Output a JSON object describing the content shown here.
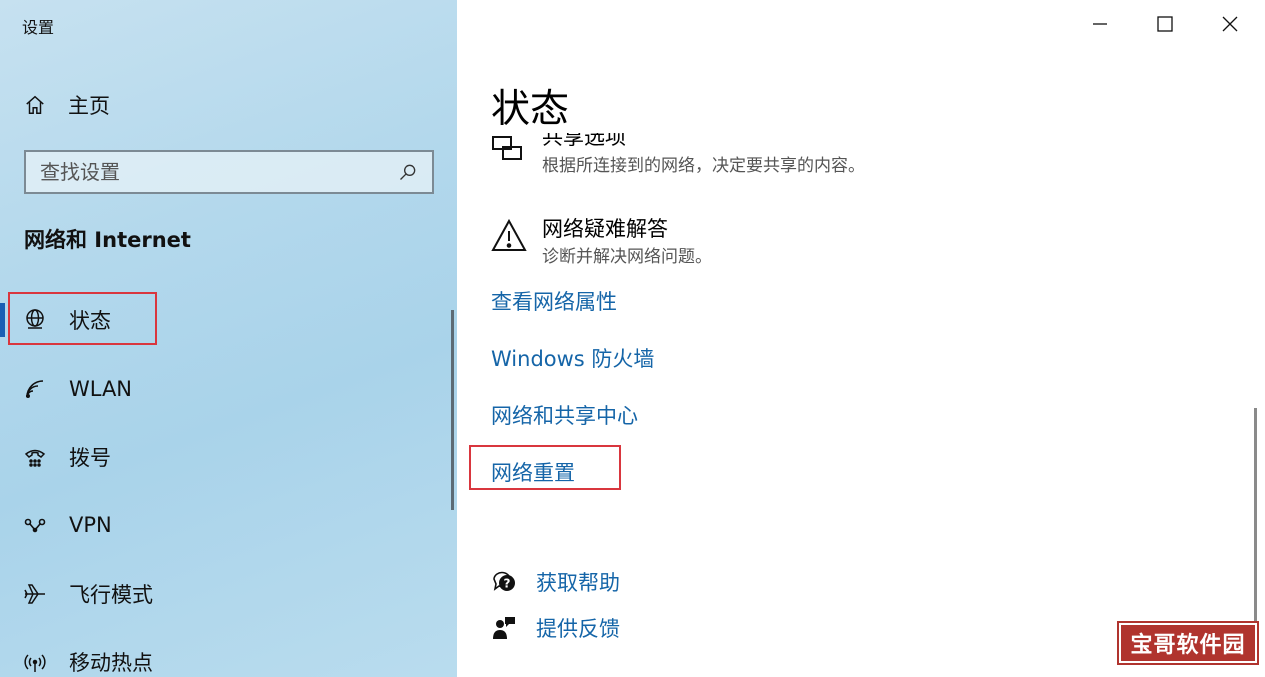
{
  "window": {
    "title": "设置"
  },
  "sidebar": {
    "home_label": "主页",
    "search_placeholder": "查找设置",
    "section_title": "网络和 Internet",
    "items": [
      {
        "label": "状态",
        "icon": "globe-monitor-icon",
        "active": true
      },
      {
        "label": "WLAN",
        "icon": "wifi-icon"
      },
      {
        "label": "拨号",
        "icon": "dialup-icon"
      },
      {
        "label": "VPN",
        "icon": "vpn-icon"
      },
      {
        "label": "飞行模式",
        "icon": "airplane-icon"
      },
      {
        "label": "移动热点",
        "icon": "hotspot-icon"
      }
    ]
  },
  "main": {
    "title": "状态",
    "options": [
      {
        "title": "共享选项",
        "desc": "根据所连接到的网络，决定要共享的内容。",
        "icon": "sharing-icon"
      },
      {
        "title": "网络疑难解答",
        "desc": "诊断并解决网络问题。",
        "icon": "warning-icon"
      }
    ],
    "links": [
      "查看网络属性",
      "Windows 防火墙",
      "网络和共享中心",
      "网络重置"
    ],
    "help": [
      {
        "label": "获取帮助",
        "icon": "help-chat-icon"
      },
      {
        "label": "提供反馈",
        "icon": "feedback-icon"
      }
    ]
  },
  "watermark": {
    "text": "宝哥软件园"
  },
  "colors": {
    "link": "#1565a8",
    "highlight": "#d9363e",
    "accent": "#1a5fb4"
  }
}
